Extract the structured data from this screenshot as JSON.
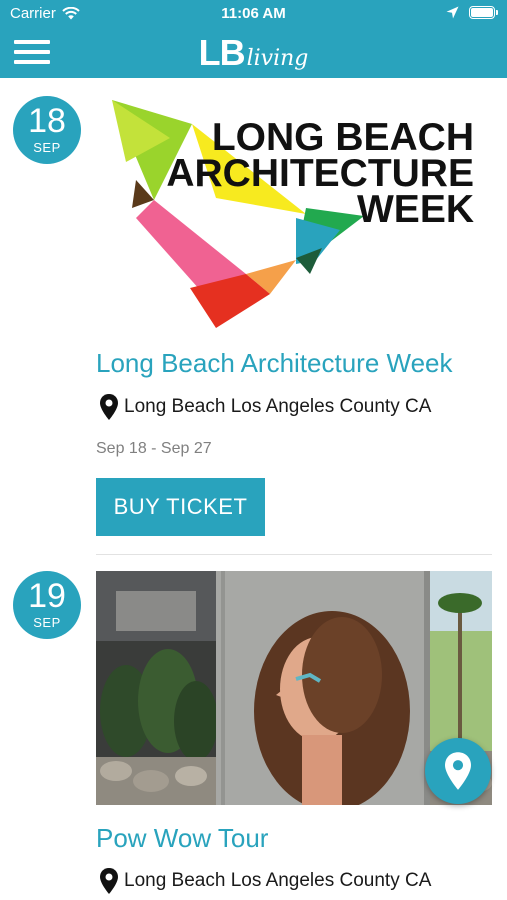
{
  "status_bar": {
    "carrier": "Carrier",
    "time": "11:06 AM"
  },
  "nav": {
    "logo_main": "LB",
    "logo_sub": "living",
    "menu_icon": "hamburger-icon",
    "accent_color": "#29a3bd"
  },
  "events": [
    {
      "day": "18",
      "month": "SEP",
      "image_text": [
        "LONG BEACH",
        "ARCHITECTURE",
        "WEEK"
      ],
      "title": "Long Beach Architecture Week",
      "location": "Long Beach Los Angeles County CA",
      "dates": "Sep 18 - Sep 27",
      "button_label": "BUY TICKET"
    },
    {
      "day": "19",
      "month": "SEP",
      "title": "Pow Wow Tour",
      "location": "Long Beach Los Angeles County CA"
    }
  ],
  "fab": {
    "icon": "map-pin-icon"
  }
}
